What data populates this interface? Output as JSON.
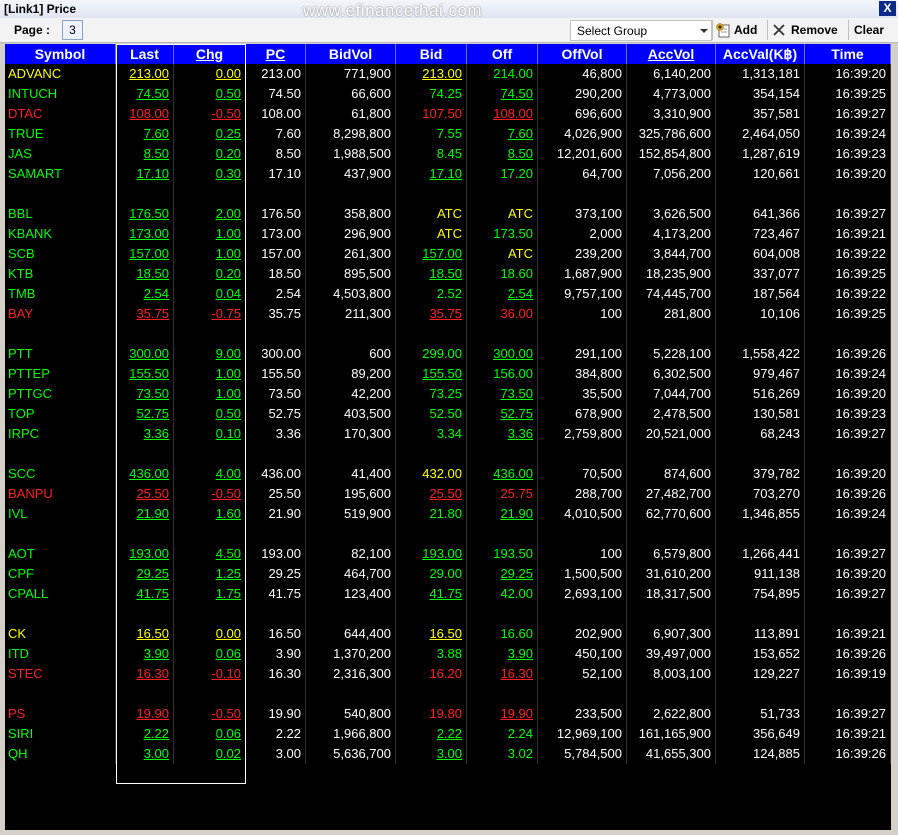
{
  "window": {
    "title": "[Link1] Price",
    "watermark": "www.efinancethai.com",
    "close_label": "X"
  },
  "toolbar": {
    "page_label": "Page :",
    "page_value": "3",
    "group_placeholder": "Select Group",
    "add_label": "Add",
    "remove_label": "Remove",
    "clear_label": "Clear"
  },
  "columns": [
    "Symbol",
    "Last",
    "Chg",
    "PC",
    "BidVol",
    "Bid",
    "Off",
    "OffVol",
    "AccVol",
    "AccVal(K฿)",
    "Time"
  ],
  "colors": {
    "up": "#00ff00",
    "down": "#ff2020",
    "unchanged": "#ffff00",
    "header": "#0000ff",
    "background": "#000000"
  },
  "rows": [
    {
      "sym": "ADVANC",
      "c": "unc",
      "last": "213.00",
      "chg": "0.00",
      "pc": "213.00",
      "bidvol": "771,900",
      "bid": "213.00",
      "bidc": "unc",
      "bidu": true,
      "off": "214.00",
      "offc": "up",
      "offu": false,
      "offvol": "46,800",
      "accvol": "6,140,200",
      "accval": "1,313,181",
      "time": "16:39:20"
    },
    {
      "sym": "INTUCH",
      "c": "up",
      "last": "74.50",
      "chg": "0.50",
      "pc": "74.50",
      "bidvol": "66,600",
      "bid": "74.25",
      "bidc": "up",
      "bidu": false,
      "off": "74.50",
      "offc": "up",
      "offu": true,
      "offvol": "290,200",
      "accvol": "4,773,000",
      "accval": "354,154",
      "time": "16:39:25"
    },
    {
      "sym": "DTAC",
      "c": "dn",
      "last": "108.00",
      "chg": "-0.50",
      "pc": "108.00",
      "bidvol": "61,800",
      "bid": "107.50",
      "bidc": "dn",
      "bidu": false,
      "off": "108.00",
      "offc": "dn",
      "offu": true,
      "offvol": "696,600",
      "accvol": "3,310,900",
      "accval": "357,581",
      "time": "16:39:27"
    },
    {
      "sym": "TRUE",
      "c": "up",
      "last": "7.60",
      "chg": "0.25",
      "pc": "7.60",
      "bidvol": "8,298,800",
      "bid": "7.55",
      "bidc": "up",
      "bidu": false,
      "off": "7.60",
      "offc": "up",
      "offu": true,
      "offvol": "4,026,900",
      "accvol": "325,786,600",
      "accval": "2,464,050",
      "time": "16:39:24"
    },
    {
      "sym": "JAS",
      "c": "up",
      "last": "8.50",
      "chg": "0.20",
      "pc": "8.50",
      "bidvol": "1,988,500",
      "bid": "8.45",
      "bidc": "up",
      "bidu": false,
      "off": "8.50",
      "offc": "up",
      "offu": true,
      "offvol": "12,201,600",
      "accvol": "152,854,800",
      "accval": "1,287,619",
      "time": "16:39:23"
    },
    {
      "sym": "SAMART",
      "c": "up",
      "last": "17.10",
      "chg": "0.30",
      "pc": "17.10",
      "bidvol": "437,900",
      "bid": "17.10",
      "bidc": "up",
      "bidu": true,
      "off": "17.20",
      "offc": "up",
      "offu": false,
      "offvol": "64,700",
      "accvol": "7,056,200",
      "accval": "120,661",
      "time": "16:39:20"
    },
    {
      "blank": true
    },
    {
      "sym": "BBL",
      "c": "up",
      "last": "176.50",
      "chg": "2.00",
      "pc": "176.50",
      "bidvol": "358,800",
      "bid": "ATC",
      "bidc": "unc",
      "bidu": false,
      "off": "ATC",
      "offc": "unc",
      "offu": false,
      "offvol": "373,100",
      "accvol": "3,626,500",
      "accval": "641,366",
      "time": "16:39:27"
    },
    {
      "sym": "KBANK",
      "c": "up",
      "last": "173.00",
      "chg": "1.00",
      "pc": "173.00",
      "bidvol": "296,900",
      "bid": "ATC",
      "bidc": "unc",
      "bidu": false,
      "off": "173.50",
      "offc": "up",
      "offu": false,
      "offvol": "2,000",
      "accvol": "4,173,200",
      "accval": "723,467",
      "time": "16:39:21"
    },
    {
      "sym": "SCB",
      "c": "up",
      "last": "157.00",
      "chg": "1.00",
      "pc": "157.00",
      "bidvol": "261,300",
      "bid": "157.00",
      "bidc": "up",
      "bidu": true,
      "off": "ATC",
      "offc": "unc",
      "offu": false,
      "offvol": "239,200",
      "accvol": "3,844,700",
      "accval": "604,008",
      "time": "16:39:22"
    },
    {
      "sym": "KTB",
      "c": "up",
      "last": "18.50",
      "chg": "0.20",
      "pc": "18.50",
      "bidvol": "895,500",
      "bid": "18.50",
      "bidc": "up",
      "bidu": true,
      "off": "18.60",
      "offc": "up",
      "offu": false,
      "offvol": "1,687,900",
      "accvol": "18,235,900",
      "accval": "337,077",
      "time": "16:39:25"
    },
    {
      "sym": "TMB",
      "c": "up",
      "last": "2.54",
      "chg": "0.04",
      "pc": "2.54",
      "bidvol": "4,503,800",
      "bid": "2.52",
      "bidc": "up",
      "bidu": false,
      "off": "2.54",
      "offc": "up",
      "offu": true,
      "offvol": "9,757,100",
      "accvol": "74,445,700",
      "accval": "187,564",
      "time": "16:39:22"
    },
    {
      "sym": "BAY",
      "c": "dn",
      "last": "35.75",
      "chg": "-0.75",
      "pc": "35.75",
      "bidvol": "211,300",
      "bid": "35.75",
      "bidc": "dn",
      "bidu": true,
      "off": "36.00",
      "offc": "dn",
      "offu": false,
      "offvol": "100",
      "accvol": "281,800",
      "accval": "10,106",
      "time": "16:39:25"
    },
    {
      "blank": true
    },
    {
      "sym": "PTT",
      "c": "up",
      "last": "300.00",
      "chg": "9.00",
      "pc": "300.00",
      "bidvol": "600",
      "bid": "299.00",
      "bidc": "up",
      "bidu": false,
      "off": "300.00",
      "offc": "up",
      "offu": true,
      "offvol": "291,100",
      "accvol": "5,228,100",
      "accval": "1,558,422",
      "time": "16:39:26"
    },
    {
      "sym": "PTTEP",
      "c": "up",
      "last": "155.50",
      "chg": "1.00",
      "pc": "155.50",
      "bidvol": "89,200",
      "bid": "155.50",
      "bidc": "up",
      "bidu": true,
      "off": "156.00",
      "offc": "up",
      "offu": false,
      "offvol": "384,800",
      "accvol": "6,302,500",
      "accval": "979,467",
      "time": "16:39:24"
    },
    {
      "sym": "PTTGC",
      "c": "up",
      "last": "73.50",
      "chg": "1.00",
      "pc": "73.50",
      "bidvol": "42,200",
      "bid": "73.25",
      "bidc": "up",
      "bidu": false,
      "off": "73.50",
      "offc": "up",
      "offu": true,
      "offvol": "35,500",
      "accvol": "7,044,700",
      "accval": "516,269",
      "time": "16:39:20"
    },
    {
      "sym": "TOP",
      "c": "up",
      "last": "52.75",
      "chg": "0.50",
      "pc": "52.75",
      "bidvol": "403,500",
      "bid": "52.50",
      "bidc": "up",
      "bidu": false,
      "off": "52.75",
      "offc": "up",
      "offu": true,
      "offvol": "678,900",
      "accvol": "2,478,500",
      "accval": "130,581",
      "time": "16:39:23"
    },
    {
      "sym": "IRPC",
      "c": "up",
      "last": "3.36",
      "chg": "0.10",
      "pc": "3.36",
      "bidvol": "170,300",
      "bid": "3.34",
      "bidc": "up",
      "bidu": false,
      "off": "3.36",
      "offc": "up",
      "offu": true,
      "offvol": "2,759,800",
      "accvol": "20,521,000",
      "accval": "68,243",
      "time": "16:39:27"
    },
    {
      "blank": true
    },
    {
      "sym": "SCC",
      "c": "up",
      "last": "436.00",
      "chg": "4.00",
      "pc": "436.00",
      "bidvol": "41,400",
      "bid": "432.00",
      "bidc": "unc",
      "bidu": false,
      "off": "436.00",
      "offc": "up",
      "offu": true,
      "offvol": "70,500",
      "accvol": "874,600",
      "accval": "379,782",
      "time": "16:39:20"
    },
    {
      "sym": "BANPU",
      "c": "dn",
      "last": "25.50",
      "chg": "-0.50",
      "pc": "25.50",
      "bidvol": "195,600",
      "bid": "25.50",
      "bidc": "dn",
      "bidu": true,
      "off": "25.75",
      "offc": "dn",
      "offu": false,
      "offvol": "288,700",
      "accvol": "27,482,700",
      "accval": "703,270",
      "time": "16:39:26"
    },
    {
      "sym": "IVL",
      "c": "up",
      "last": "21.90",
      "chg": "1.60",
      "pc": "21.90",
      "bidvol": "519,900",
      "bid": "21.80",
      "bidc": "up",
      "bidu": false,
      "off": "21.90",
      "offc": "up",
      "offu": true,
      "offvol": "4,010,500",
      "accvol": "62,770,600",
      "accval": "1,346,855",
      "time": "16:39:24"
    },
    {
      "blank": true
    },
    {
      "sym": "AOT",
      "c": "up",
      "last": "193.00",
      "chg": "4.50",
      "pc": "193.00",
      "bidvol": "82,100",
      "bid": "193.00",
      "bidc": "up",
      "bidu": true,
      "off": "193.50",
      "offc": "up",
      "offu": false,
      "offvol": "100",
      "accvol": "6,579,800",
      "accval": "1,266,441",
      "time": "16:39:27"
    },
    {
      "sym": "CPF",
      "c": "up",
      "last": "29.25",
      "chg": "1.25",
      "pc": "29.25",
      "bidvol": "464,700",
      "bid": "29.00",
      "bidc": "up",
      "bidu": false,
      "off": "29.25",
      "offc": "up",
      "offu": true,
      "offvol": "1,500,500",
      "accvol": "31,610,200",
      "accval": "911,138",
      "time": "16:39:20"
    },
    {
      "sym": "CPALL",
      "c": "up",
      "last": "41.75",
      "chg": "1.75",
      "pc": "41.75",
      "bidvol": "123,400",
      "bid": "41.75",
      "bidc": "up",
      "bidu": true,
      "off": "42.00",
      "offc": "up",
      "offu": false,
      "offvol": "2,693,100",
      "accvol": "18,317,500",
      "accval": "754,895",
      "time": "16:39:27"
    },
    {
      "blank": true
    },
    {
      "sym": "CK",
      "c": "unc",
      "last": "16.50",
      "chg": "0.00",
      "pc": "16.50",
      "bidvol": "644,400",
      "bid": "16.50",
      "bidc": "unc",
      "bidu": true,
      "off": "16.60",
      "offc": "up",
      "offu": false,
      "offvol": "202,900",
      "accvol": "6,907,300",
      "accval": "113,891",
      "time": "16:39:21"
    },
    {
      "sym": "ITD",
      "c": "up",
      "last": "3.90",
      "chg": "0.06",
      "pc": "3.90",
      "bidvol": "1,370,200",
      "bid": "3.88",
      "bidc": "up",
      "bidu": false,
      "off": "3.90",
      "offc": "up",
      "offu": true,
      "offvol": "450,100",
      "accvol": "39,497,000",
      "accval": "153,652",
      "time": "16:39:26"
    },
    {
      "sym": "STEC",
      "c": "dn",
      "last": "16.30",
      "chg": "-0.10",
      "pc": "16.30",
      "bidvol": "2,316,300",
      "bid": "16.20",
      "bidc": "dn",
      "bidu": false,
      "off": "16.30",
      "offc": "dn",
      "offu": true,
      "offvol": "52,100",
      "accvol": "8,003,100",
      "accval": "129,227",
      "time": "16:39:19"
    },
    {
      "blank": true
    },
    {
      "sym": "PS",
      "c": "dn",
      "last": "19.90",
      "chg": "-0.50",
      "pc": "19.90",
      "bidvol": "540,800",
      "bid": "19.80",
      "bidc": "dn",
      "bidu": false,
      "off": "19.90",
      "offc": "dn",
      "offu": true,
      "offvol": "233,500",
      "accvol": "2,622,800",
      "accval": "51,733",
      "time": "16:39:27"
    },
    {
      "sym": "SIRI",
      "c": "up",
      "last": "2.22",
      "chg": "0.06",
      "pc": "2.22",
      "bidvol": "1,966,800",
      "bid": "2.22",
      "bidc": "up",
      "bidu": true,
      "off": "2.24",
      "offc": "up",
      "offu": false,
      "offvol": "12,969,100",
      "accvol": "161,165,900",
      "accval": "356,649",
      "time": "16:39:21"
    },
    {
      "sym": "QH",
      "c": "up",
      "last": "3.00",
      "chg": "0.02",
      "pc": "3.00",
      "bidvol": "5,636,700",
      "bid": "3.00",
      "bidc": "up",
      "bidu": true,
      "off": "3.02",
      "offc": "up",
      "offu": false,
      "offvol": "5,784,500",
      "accvol": "41,655,300",
      "accval": "124,885",
      "time": "16:39:26"
    }
  ]
}
